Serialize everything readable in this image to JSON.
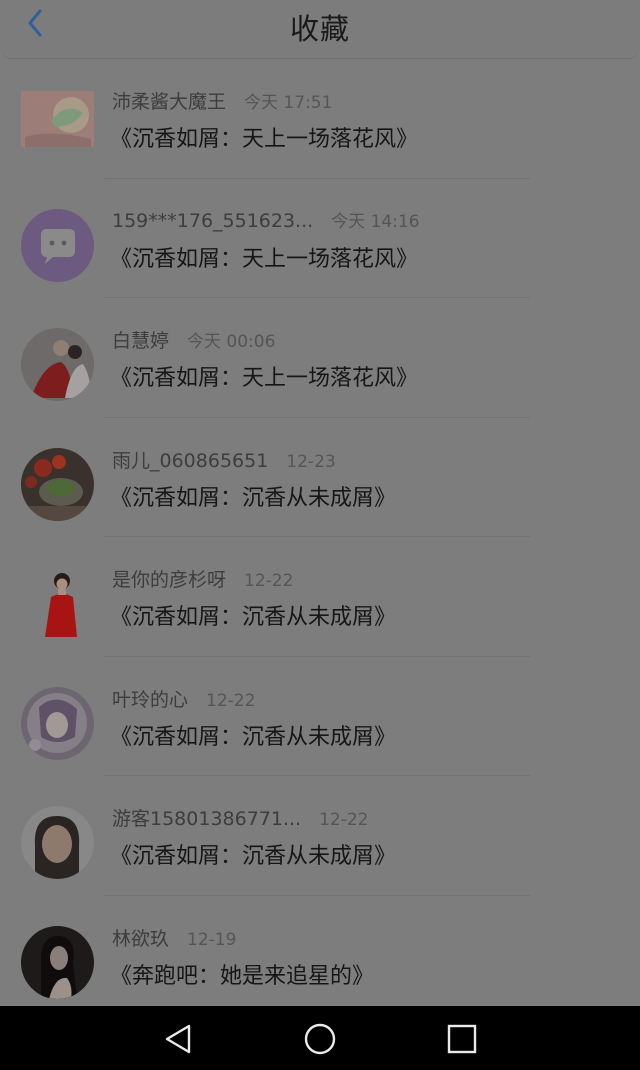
{
  "header": {
    "title": "收藏",
    "back_icon": "chevron-left-icon",
    "accent": "#3a6fb0"
  },
  "items": [
    {
      "name": "沛柔酱大魔王",
      "time": "今天 17:51",
      "content": "《沉香如屑：天上一场落花风》",
      "avatar": "floral-avatar"
    },
    {
      "name": "159***176_551623...",
      "time": "今天 14:16",
      "content": "《沉香如屑：天上一场落花风》",
      "avatar": "chat-bubble-avatar"
    },
    {
      "name": "白慧婷",
      "time": "今天 00:06",
      "content": "《沉香如屑：天上一场落花风》",
      "avatar": "costume-drama-avatar"
    },
    {
      "name": "雨儿_060865651",
      "time": "12-23",
      "content": "《沉香如屑：沉香从未成屑》",
      "avatar": "food-avatar"
    },
    {
      "name": "是你的彦杉呀",
      "time": "12-22",
      "content": "《沉香如屑：沉香从未成屑》",
      "avatar": "red-dress-avatar"
    },
    {
      "name": "叶玲的心",
      "time": "12-22",
      "content": "《沉香如屑：沉香从未成屑》",
      "avatar": "anime-girl-avatar"
    },
    {
      "name": "游客15801386771...",
      "time": "12-22",
      "content": "《沉香如屑：沉香从未成屑》",
      "avatar": "portrait-avatar"
    },
    {
      "name": "林欲玖",
      "time": "12-19",
      "content": "《奔跑吧：她是来追星的》",
      "avatar": "dark-portrait-avatar"
    }
  ],
  "navbar": {
    "back_icon": "triangle-back-icon",
    "home_icon": "circle-home-icon",
    "recents_icon": "square-recents-icon"
  }
}
